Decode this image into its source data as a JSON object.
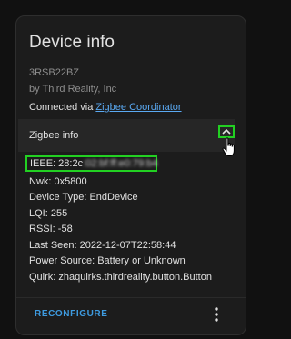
{
  "card": {
    "title": "Device info",
    "model": "3RSB22BZ",
    "manufacturer": "by Third Reality, Inc",
    "connected_prefix": "Connected via ",
    "connected_link": "Zigbee Coordinator"
  },
  "zigbee_info": {
    "title": "Zigbee info",
    "expanded": true,
    "chevron_icon": "chevron-up-icon",
    "ieee_label": "IEEE: 28:2c",
    "ieee_redacted": ":02:bf:ff:e0:79:b4",
    "lines": [
      "Nwk: 0x5800",
      "Device Type: EndDevice",
      "LQI: 255",
      "RSSI: -58",
      "Last Seen: 2022-12-07T22:58:44",
      "Power Source: Battery or Unknown",
      "Quirk: zhaquirks.thirdreality.button.Button"
    ]
  },
  "actions": {
    "reconfigure_label": "RECONFIGURE",
    "more_icon": "more-vertical-icon"
  },
  "colors": {
    "accent": "#3e9be0",
    "link": "#5aa9f2",
    "highlight": "#22d022",
    "card_bg": "#1c1c1c",
    "page_bg": "#111111"
  }
}
